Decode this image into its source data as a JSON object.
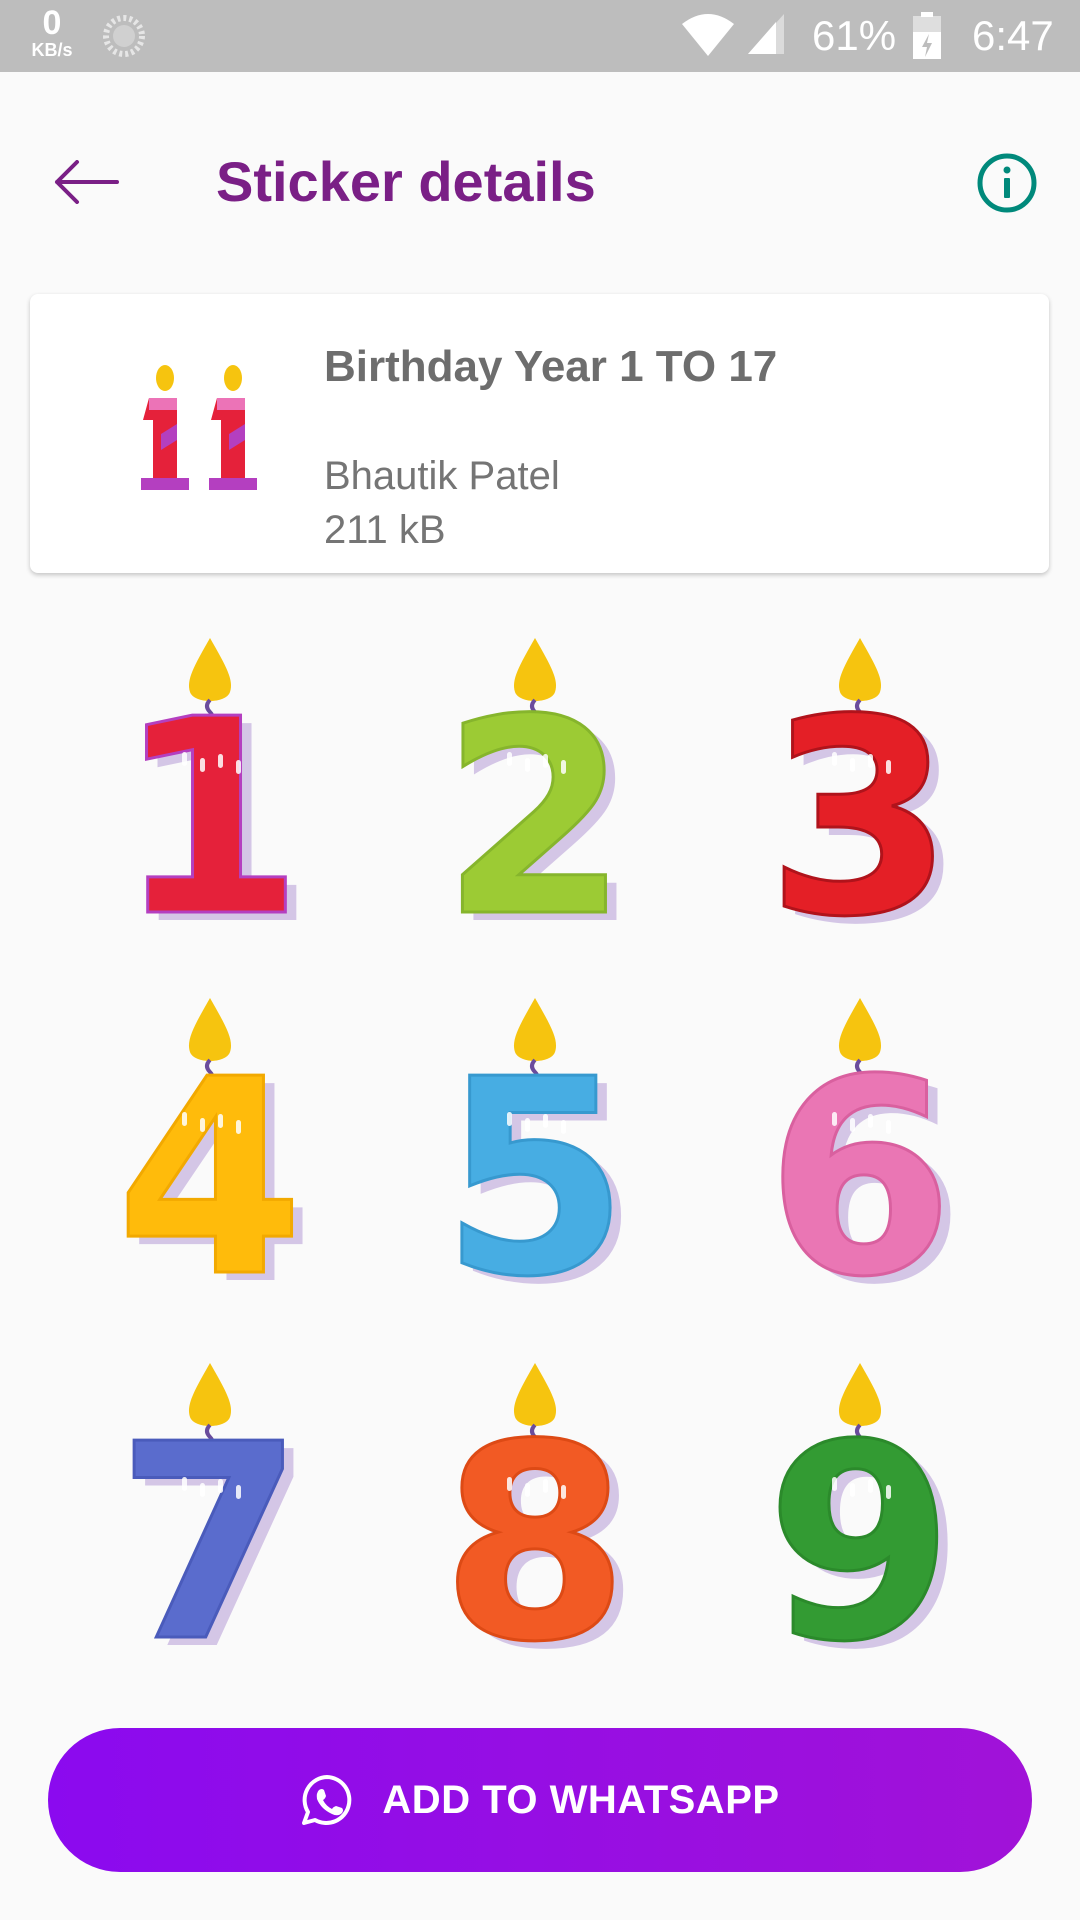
{
  "status_bar": {
    "speed_value": "0",
    "speed_unit": "KB/s",
    "battery_percent": "61%",
    "time": "6:47",
    "icons": [
      "sync-icon",
      "wifi-icon",
      "signal-icon",
      "battery-icon"
    ]
  },
  "app_bar": {
    "title": "Sticker details",
    "back_icon": "arrow-left-icon",
    "info_icon": "info-icon",
    "accent_color": "#7a1f86",
    "info_color": "#00897b"
  },
  "pack": {
    "name": "Birthday Year 1 TO 17",
    "author": "Bhautik Patel",
    "size": "211 kB",
    "tray_sticker": "11"
  },
  "stickers": [
    {
      "digit": "1",
      "color": "#e5213a",
      "accent": "#b43fc0",
      "top": "#ec73b7"
    },
    {
      "digit": "2",
      "color": "#9ccb34",
      "accent": "#86b52c",
      "top": "#9ccb34"
    },
    {
      "digit": "3",
      "color": "#e41f26",
      "accent": "#b0131b",
      "top": "#e41f26"
    },
    {
      "digit": "4",
      "color": "#ffbb0b",
      "accent": "#f2a900",
      "top": "#ffbb0b"
    },
    {
      "digit": "5",
      "color": "#47ade3",
      "accent": "#3799cf",
      "top": "#47ade3"
    },
    {
      "digit": "6",
      "color": "#ea76b4",
      "accent": "#d9609f",
      "top": "#ea76b4"
    },
    {
      "digit": "7",
      "color": "#5a6ccd",
      "accent": "#4a5bbb",
      "top": "#5a6ccd"
    },
    {
      "digit": "8",
      "color": "#f25a24",
      "accent": "#dd4a15",
      "top": "#f25a24"
    },
    {
      "digit": "9",
      "color": "#339b33",
      "accent": "#2b8a2b",
      "top": "#339b33"
    }
  ],
  "add_button": {
    "label": "ADD TO WHATSAPP",
    "icon": "whatsapp-icon",
    "color_start": "#8b0aef",
    "color_end": "#a112d8"
  }
}
